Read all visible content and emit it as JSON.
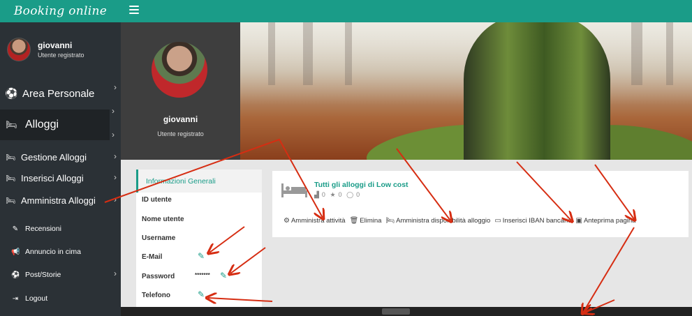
{
  "brand": "Booking online",
  "user": {
    "name": "giovanni",
    "role": "Utente registrato"
  },
  "sidebar": {
    "items": [
      {
        "label": "Area Personale",
        "icon": "soccer-ball-icon"
      },
      {
        "label": "Alloggi",
        "icon": "bed-icon"
      },
      {
        "label": "Gestione Alloggi",
        "icon": "bed-icon"
      },
      {
        "label": "Inserisci Alloggi",
        "icon": "bed-icon"
      },
      {
        "label": "Amministra Alloggi",
        "icon": "bed-icon"
      },
      {
        "label": "Recensioni",
        "icon": "edit-icon"
      },
      {
        "label": "Annuncio in cima",
        "icon": "megaphone-icon"
      },
      {
        "label": "Post/Storie",
        "icon": "soccer-ball-icon"
      },
      {
        "label": "Logout",
        "icon": "logout-icon"
      }
    ]
  },
  "info": {
    "header": "Informazioni Generali",
    "rows": [
      "ID utente",
      "Nome utente",
      "Username",
      "E-Mail",
      "Password",
      "Telefono"
    ],
    "password_mask": "*******"
  },
  "accommodation": {
    "title": "Tutti gli alloggi di Low cost",
    "stats": {
      "chart": "0",
      "stars": "0",
      "comments": "0"
    },
    "actions": [
      {
        "label": "Amministra attività",
        "icon": "cogs-icon"
      },
      {
        "label": "Elimina",
        "icon": "trash-icon"
      },
      {
        "label": "Amministra disponibilità alloggio",
        "icon": "bed-icon"
      },
      {
        "label": "Inserisci IBAN bancario",
        "icon": "credit-card-icon"
      },
      {
        "label": "Anteprima pagina",
        "icon": "id-card-icon"
      }
    ]
  },
  "colors": {
    "accent": "#1a9c88",
    "sidebar": "#2b3136",
    "profile_panel": "#3e3e3e",
    "annotation": "#d62d12"
  }
}
